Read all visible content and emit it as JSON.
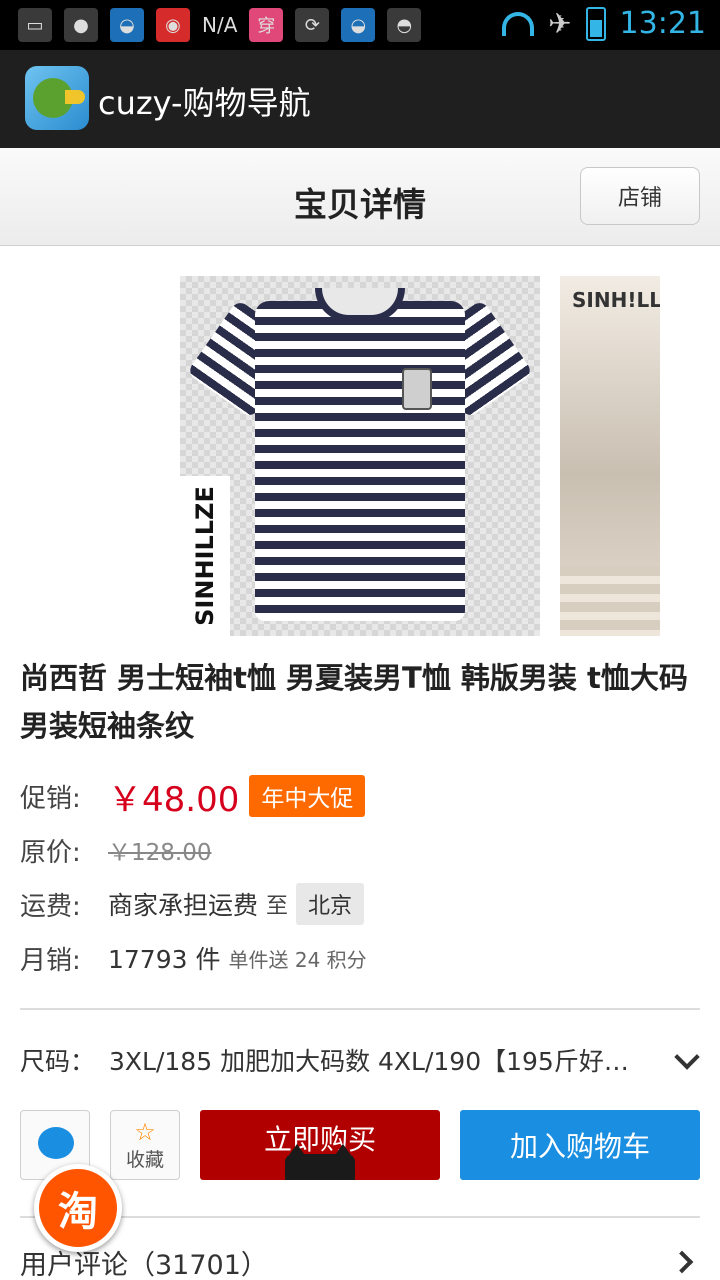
{
  "status_bar": {
    "carrier": "N/A",
    "time": "13:21"
  },
  "app": {
    "title": "cuzy-购物导航"
  },
  "header": {
    "title": "宝贝详情",
    "shop_button": "店铺"
  },
  "gallery": {
    "main_brand": "SINHILLZE",
    "side_brand": "SINH!LLZE"
  },
  "product": {
    "title": "尚西哲 男士短袖t恤 男夏装男T恤 韩版男装 t恤大码男装短袖条纹",
    "promo_label": "促销:",
    "promo_price": "￥48.00",
    "promo_tag": "年中大促",
    "orig_label": "原价:",
    "orig_price": "￥128.00",
    "ship_label": "运费:",
    "ship_text": "商家承担运费",
    "ship_to": "至",
    "ship_city": "北京",
    "sales_label": "月销:",
    "sales_count": "17793 件",
    "sales_note": "单件送 24 积分",
    "size_label": "尺码：",
    "size_value": "3XL/185 加肥加大码数 4XL/190【195斤好…"
  },
  "actions": {
    "fav_label": "收藏",
    "buy_label": "立即购买",
    "cart_label": "加入购物车",
    "taobao_label": "淘"
  },
  "reviews": {
    "label": "用户评论（31701）"
  },
  "colors": {
    "price_red": "#d6001c",
    "promo_orange": "#ff6a00",
    "buy_red": "#b10000",
    "cart_blue": "#1a8ee0",
    "status_blue": "#33b5e5"
  }
}
